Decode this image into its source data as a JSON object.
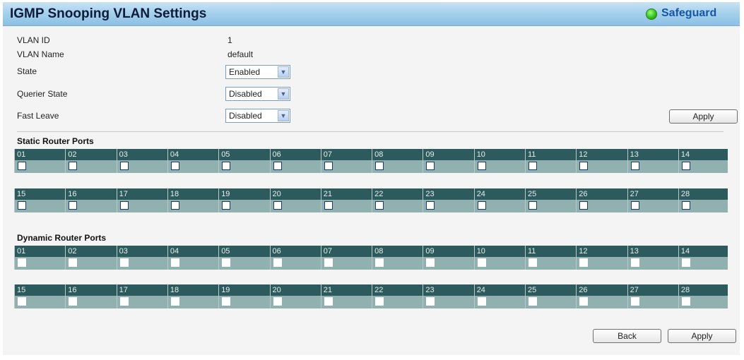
{
  "header": {
    "title": "IGMP Snooping VLAN Settings",
    "safeguard_label": "Safeguard",
    "safeguard_color": "#35c21f"
  },
  "form": {
    "vlan_id_label": "VLAN ID",
    "vlan_id_value": "1",
    "vlan_name_label": "VLAN Name",
    "vlan_name_value": "default",
    "state_label": "State",
    "state_value": "Enabled",
    "querier_label": "Querier State",
    "querier_value": "Disabled",
    "fastleave_label": "Fast Leave",
    "fastleave_value": "Disabled",
    "apply_label": "Apply"
  },
  "static_ports": {
    "title": "Static Router Ports",
    "ports": [
      "01",
      "02",
      "03",
      "04",
      "05",
      "06",
      "07",
      "08",
      "09",
      "10",
      "11",
      "12",
      "13",
      "14",
      "15",
      "16",
      "17",
      "18",
      "19",
      "20",
      "21",
      "22",
      "23",
      "24",
      "25",
      "26",
      "27",
      "28"
    ]
  },
  "dynamic_ports": {
    "title": "Dynamic Router Ports",
    "ports": [
      "01",
      "02",
      "03",
      "04",
      "05",
      "06",
      "07",
      "08",
      "09",
      "10",
      "11",
      "12",
      "13",
      "14",
      "15",
      "16",
      "17",
      "18",
      "19",
      "20",
      "21",
      "22",
      "23",
      "24",
      "25",
      "26",
      "27",
      "28"
    ]
  },
  "footer": {
    "back_label": "Back",
    "apply_label": "Apply"
  },
  "icons": {
    "select_arrow": "chevron-down-icon",
    "safeguard_indicator": "status-dot-icon"
  }
}
